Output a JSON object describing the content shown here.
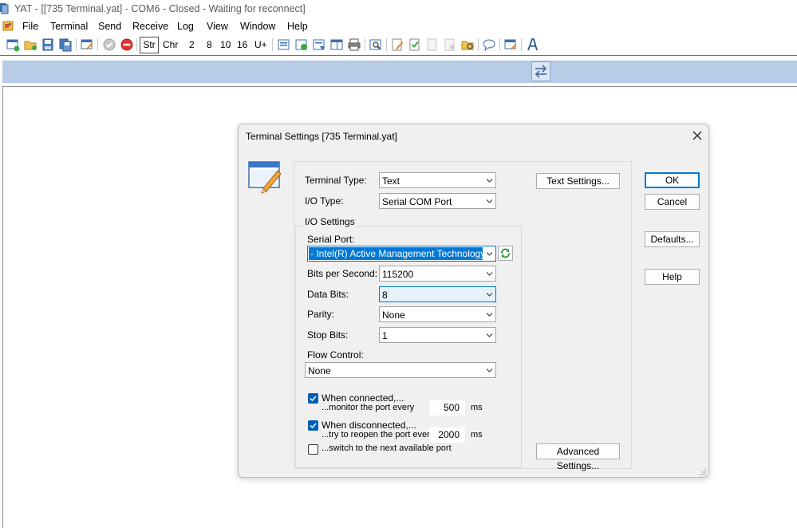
{
  "window": {
    "title": "YAT - [[735 Terminal.yat] - COM6 - Closed - Waiting for reconnect]",
    "menu": [
      "File",
      "Terminal",
      "Send",
      "Receive",
      "Log",
      "View",
      "Window",
      "Help"
    ],
    "toolbar": {
      "radix_labels": [
        "Str",
        "Chr",
        "2",
        "8",
        "10",
        "16",
        "U+"
      ]
    }
  },
  "dialog": {
    "title": "Terminal Settings [735 Terminal.yat]",
    "terminal_type_label": "Terminal Type:",
    "terminal_type_value": "Text",
    "io_type_label": "I/O Type:",
    "io_type_value": "Serial COM Port",
    "text_settings_button": "Text Settings...",
    "io_settings_group": "I/O Settings",
    "serial_port_label": "Serial Port:",
    "serial_port_value": "- Intel(R) Active Management Technology - SOL",
    "bits_per_second_label": "Bits per Second:",
    "bits_per_second_value": "115200",
    "data_bits_label": "Data Bits:",
    "data_bits_value": "8",
    "parity_label": "Parity:",
    "parity_value": "None",
    "stop_bits_label": "Stop Bits:",
    "stop_bits_value": "1",
    "flow_control_label": "Flow Control:",
    "flow_control_value": "None",
    "when_connected_line1": "When connected,...",
    "when_connected_line2": "...monitor the port every",
    "monitor_interval": "500",
    "monitor_unit": "ms",
    "when_disconnected_line1": "When disconnected,...",
    "when_disconnected_line2": "...try to reopen the port every",
    "reopen_interval": "2000",
    "reopen_unit": "ms",
    "switch_port_label": "...switch to the next available port",
    "advanced_settings_button": "Advanced Settings...",
    "ok_button": "OK",
    "cancel_button": "Cancel",
    "defaults_button": "Defaults...",
    "help_button": "Help"
  },
  "colors": {
    "accent": "#0078d7",
    "checkbox_checked": "#005fb8",
    "split_bar": "#b8cce8"
  }
}
